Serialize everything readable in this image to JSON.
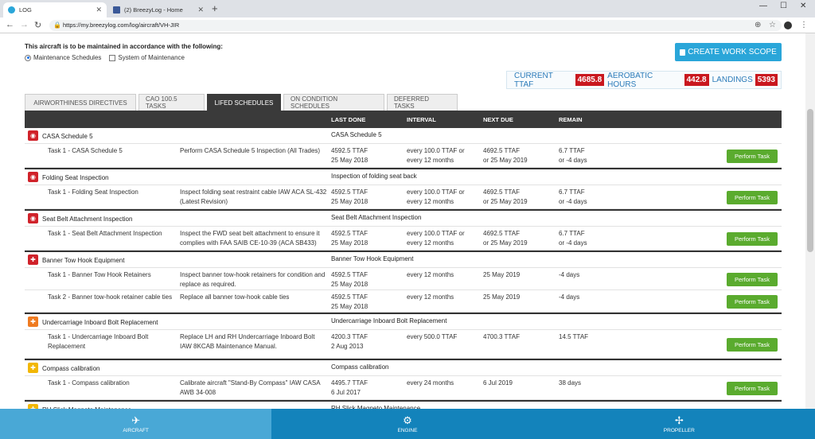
{
  "browser": {
    "tabs": [
      {
        "title": "LOG",
        "active": true
      },
      {
        "title": "(2) BreezyLog - Home",
        "active": false
      }
    ],
    "url": "https://my.breezylog.com/log/aircraft/VH-JIR"
  },
  "maintenance": {
    "title": "This aircraft is to be maintained in accordance with the following:",
    "options": [
      {
        "label": "Maintenance Schedules",
        "selected": true
      },
      {
        "label": "System of Maintenance",
        "selected": false
      }
    ]
  },
  "create_button": "CREATE WORK SCOPE",
  "stats": {
    "ttaf_label": "CURRENT TTAF",
    "ttaf_value": "4685.8",
    "aero_label": "AEROBATIC HOURS",
    "aero_value": "442.8",
    "landings_label": "LANDINGS",
    "landings_value": "5393"
  },
  "page_tabs": [
    {
      "label": "AIRWORTHINESS DIRECTIVES",
      "active": false
    },
    {
      "label": "CAO 100.5 TASKS",
      "active": false
    },
    {
      "label": "LIFED SCHEDULES",
      "active": true
    },
    {
      "label": "ON CONDITION SCHEDULES",
      "active": false
    },
    {
      "label": "DEFERRED TASKS",
      "active": false
    }
  ],
  "columns": {
    "last_done": "LAST DONE",
    "interval": "INTERVAL",
    "next_due": "NEXT DUE",
    "remain": "REMAIN"
  },
  "perform_label": "Perform Task",
  "groups": [
    {
      "name": "CASA Schedule 5",
      "desc": "CASA Schedule 5",
      "icon": "eye-icon",
      "color": "#d0222a",
      "tasks": [
        {
          "name": "Task 1 - CASA Schedule 5",
          "desc": "Perform CASA Schedule 5 Inspection (All Trades)",
          "last": "4592.5 TTAF\n25 May 2018",
          "interval": "every 100.0 TTAF or\nevery 12 months",
          "next": "4692.5 TTAF\nor 25 May 2019",
          "remain": "6.7 TTAF\nor -4 days"
        }
      ]
    },
    {
      "name": "Folding Seat Inspection",
      "desc": "Inspection of folding seat back",
      "icon": "eye-icon",
      "color": "#d0222a",
      "tasks": [
        {
          "name": "Task 1 - Folding Seat Inspection",
          "desc": "Inspect folding seat restraint cable IAW ACA SL-432 (Latest Revision)",
          "last": "4592.5 TTAF\n25 May 2018",
          "interval": "every 100.0 TTAF or\nevery 12 months",
          "next": "4692.5 TTAF\nor 25 May 2019",
          "remain": "6.7 TTAF\nor -4 days"
        }
      ]
    },
    {
      "name": "Seat Belt Attachment Inspection",
      "desc": "Seat Belt Attachment Inspection",
      "icon": "eye-icon",
      "color": "#d0222a",
      "tasks": [
        {
          "name": "Task 1 - Seat Belt Attachment Inspection",
          "desc": "Inspect the FWD seat belt attachment to ensure it complies with FAA SAIB CE-10-39 (ACA SB433)",
          "last": "4592.5 TTAF\n25 May 2018",
          "interval": "every 100.0 TTAF or\nevery 12 months",
          "next": "4692.5 TTAF\nor 25 May 2019",
          "remain": "6.7 TTAF\nor -4 days"
        }
      ]
    },
    {
      "name": "Banner Tow Hook Equipment",
      "desc": "Banner Tow Hook Equipment",
      "icon": "puzzle-icon",
      "color": "#d0222a",
      "tasks": [
        {
          "name": "Task 1 - Banner Tow Hook Retainers",
          "desc": "Inspect banner tow-hook retainers for condition and replace as required.",
          "last": "4592.5 TTAF\n25 May 2018",
          "interval": "every 12 months",
          "next": "25 May 2019",
          "remain": "-4 days"
        },
        {
          "name": "Task 2 - Banner tow-hook retainer cable ties",
          "desc": "Replace all banner tow-hook cable ties",
          "last": "4592.5 TTAF\n25 May 2018",
          "interval": "every 12 months",
          "next": "25 May 2019",
          "remain": "-4 days"
        }
      ]
    },
    {
      "name": "Undercarriage Inboard Bolt Replacement",
      "desc": "Undercarriage Inboard Bolt Replacement",
      "icon": "puzzle-icon",
      "color": "#ef7b21",
      "tasks": [
        {
          "name": "Task 1 - Undercarriage Inboard Bolt Replacement",
          "desc": "Replace LH and RH Undercarriage Inboard Bolt IAW 8KCAB Maintenance Manual.",
          "last": "4200.3 TTAF\n2 Aug 2013",
          "interval": "every 500.0 TTAF",
          "next": "4700.3 TTAF",
          "remain": "14.5 TTAF"
        }
      ]
    },
    {
      "name": "Compass calibration",
      "desc": "Compass calibration",
      "icon": "puzzle-icon",
      "color": "#f2b705",
      "tasks": [
        {
          "name": "Task 1 - Compass calibration",
          "desc": "Calibrate aircraft \"Stand-By Compass\" IAW CASA AWB 34-008",
          "last": "4495.7 TTAF\n6 Jul 2017",
          "interval": "every 24 months",
          "next": "6 Jul 2019",
          "remain": "38 days"
        }
      ]
    },
    {
      "name": "RH Slick Magneto Maintenance",
      "desc": "RH Slick Magneto Maintenance",
      "icon": "puzzle-icon",
      "color": "#f2b705",
      "tasks": []
    }
  ],
  "bottom_nav": [
    {
      "label": "AIRCRAFT",
      "icon": "airplane-icon",
      "active": true
    },
    {
      "label": "ENGINE",
      "icon": "engine-icon",
      "active": false
    },
    {
      "label": "PROPELLER",
      "icon": "propeller-icon",
      "active": false
    }
  ]
}
